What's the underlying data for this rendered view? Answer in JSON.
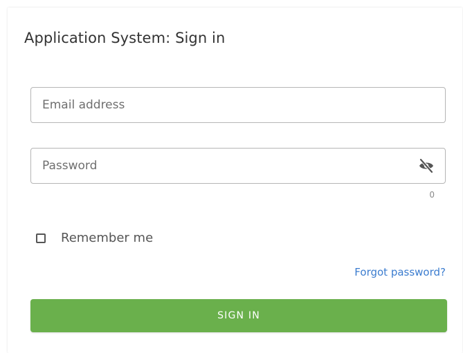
{
  "header": {
    "title": "Application System: Sign in"
  },
  "form": {
    "email": {
      "value": "",
      "placeholder": "Email address"
    },
    "password": {
      "value": "",
      "placeholder": "Password",
      "visibility_icon": "eye-off-icon",
      "char_count": "0"
    },
    "remember": {
      "label": "Remember me",
      "checked": false
    },
    "forgot_label": "Forgot password?",
    "submit_label": "SIGN IN"
  },
  "colors": {
    "primary_button": "#6ab04c",
    "link": "#3b7ccf",
    "border": "#b5b5b5"
  }
}
